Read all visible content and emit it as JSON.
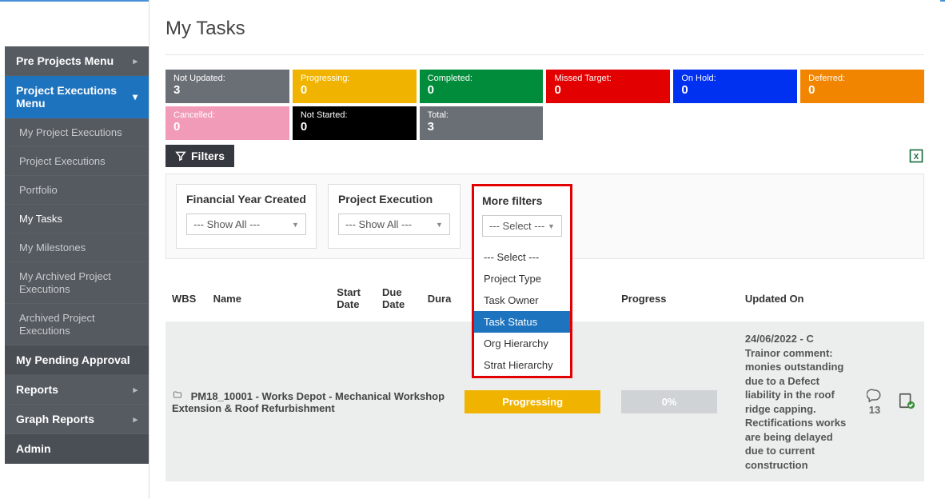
{
  "page_title": "My Tasks",
  "sidebar": {
    "pre_projects": "Pre Projects Menu",
    "project_exec": "Project Executions Menu",
    "items": [
      "My Project Executions",
      "Project Executions",
      "Portfolio",
      "My Tasks",
      "My Milestones",
      "My Archived Project Executions",
      "Archived Project Executions"
    ],
    "pending": "My Pending Approval",
    "reports": "Reports",
    "graph_reports": "Graph Reports",
    "admin": "Admin"
  },
  "tiles": [
    {
      "label": "Not Updated:",
      "value": "3",
      "cls": "tile-grey"
    },
    {
      "label": "Progressing:",
      "value": "0",
      "cls": "tile-yellow"
    },
    {
      "label": "Completed:",
      "value": "0",
      "cls": "tile-green"
    },
    {
      "label": "Missed Target:",
      "value": "0",
      "cls": "tile-red"
    },
    {
      "label": "On Hold:",
      "value": "0",
      "cls": "tile-blue"
    },
    {
      "label": "Deferred:",
      "value": "0",
      "cls": "tile-orange"
    },
    {
      "label": "Cancelled:",
      "value": "0",
      "cls": "tile-pink"
    },
    {
      "label": "Not Started:",
      "value": "0",
      "cls": "tile-black"
    },
    {
      "label": "Total:",
      "value": "3",
      "cls": "tile-grey"
    }
  ],
  "filters_button": "Filters",
  "filter_blocks": {
    "fy_label": "Financial Year Created",
    "fy_value": "--- Show All ---",
    "pe_label": "Project Execution",
    "pe_value": "--- Show All ---",
    "more_label": "More filters",
    "more_value": "--- Select ---",
    "more_options": [
      "--- Select ---",
      "Project Type",
      "Task Owner",
      "Task Status",
      "Org Hierarchy",
      "Strat Hierarchy"
    ],
    "more_highlight_index": 3
  },
  "table": {
    "headers": [
      "WBS",
      "Name",
      "Start Date",
      "Due Date",
      "Dura",
      "",
      "",
      "Progress",
      "Updated On",
      "",
      ""
    ],
    "row": {
      "name": "PM18_10001 - Works Depot - Mechanical Workshop Extension & Roof Refurbishment",
      "status": "Progressing",
      "pct": "0%",
      "updated": "24/06/2022 - C Trainor comment: monies outstanding due to a Defect liability in the roof ridge capping. Rectifications works are being delayed due to current construction",
      "comment_count": "13"
    }
  }
}
